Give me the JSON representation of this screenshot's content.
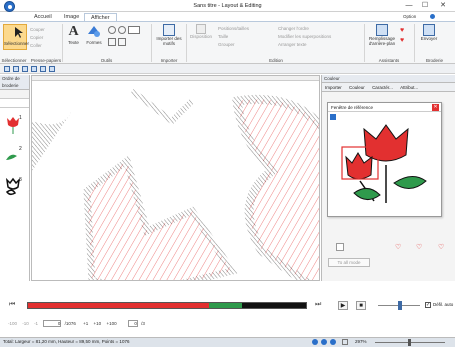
{
  "window": {
    "title": "Sans titre - Layout & Editing",
    "minimize": "—",
    "maximize": "☐",
    "close": "✕"
  },
  "tabs": [
    "Accueil",
    "Image",
    "Afficher"
  ],
  "option": "Option",
  "ribbon": {
    "select_label": "Sélectionner",
    "cut": "Couper",
    "copy": "Copier",
    "paste": "Coller",
    "text": "Texte",
    "shapes": "Formes",
    "import_label": "Importer des motifs",
    "arrange": "Disposition",
    "dimensions": "Positions/tailles",
    "size": "Taille",
    "group": "Grouper",
    "stitch_edit": "Changer l'ordre",
    "edit_remove": "Modifier les superpositions",
    "sort_stitch": "Arranger texte",
    "bg_fill": "Remplissage d'arrière-plan",
    "send": "Envoyer",
    "groups": [
      "Sélectionner",
      "Presse-papiers",
      "Outils",
      "Importer",
      "Edition",
      "Assistants",
      "Broderie"
    ]
  },
  "order_panel": {
    "title": "Ordre de broderie",
    "items": [
      "1",
      "2",
      "3"
    ]
  },
  "right_panel": {
    "title": "Couleur",
    "tabs": [
      "Importer",
      "Couleur",
      "Caractér...",
      "Attribut..."
    ],
    "to_all_mode": "To all mode",
    "ref": {
      "title": "Fenêtre de référence"
    }
  },
  "stitch_bar": {
    "fields": [
      "-100",
      "-10",
      "-1",
      "0",
      "/1076",
      "+1",
      "+10",
      "+100",
      "0",
      "/3"
    ]
  },
  "defile_label": "Défil. auto",
  "status": {
    "left": "Total: Largeur = 81,20 mm, Hauteur = 89,50 mm, Points = 1076",
    "zoom": "297%"
  },
  "colors": {
    "accent": "#2a6fc9",
    "red": "#e23030",
    "green": "#2f9a4c"
  },
  "progress": {
    "red_fraction": 0.65,
    "green_fraction": 0.12
  }
}
